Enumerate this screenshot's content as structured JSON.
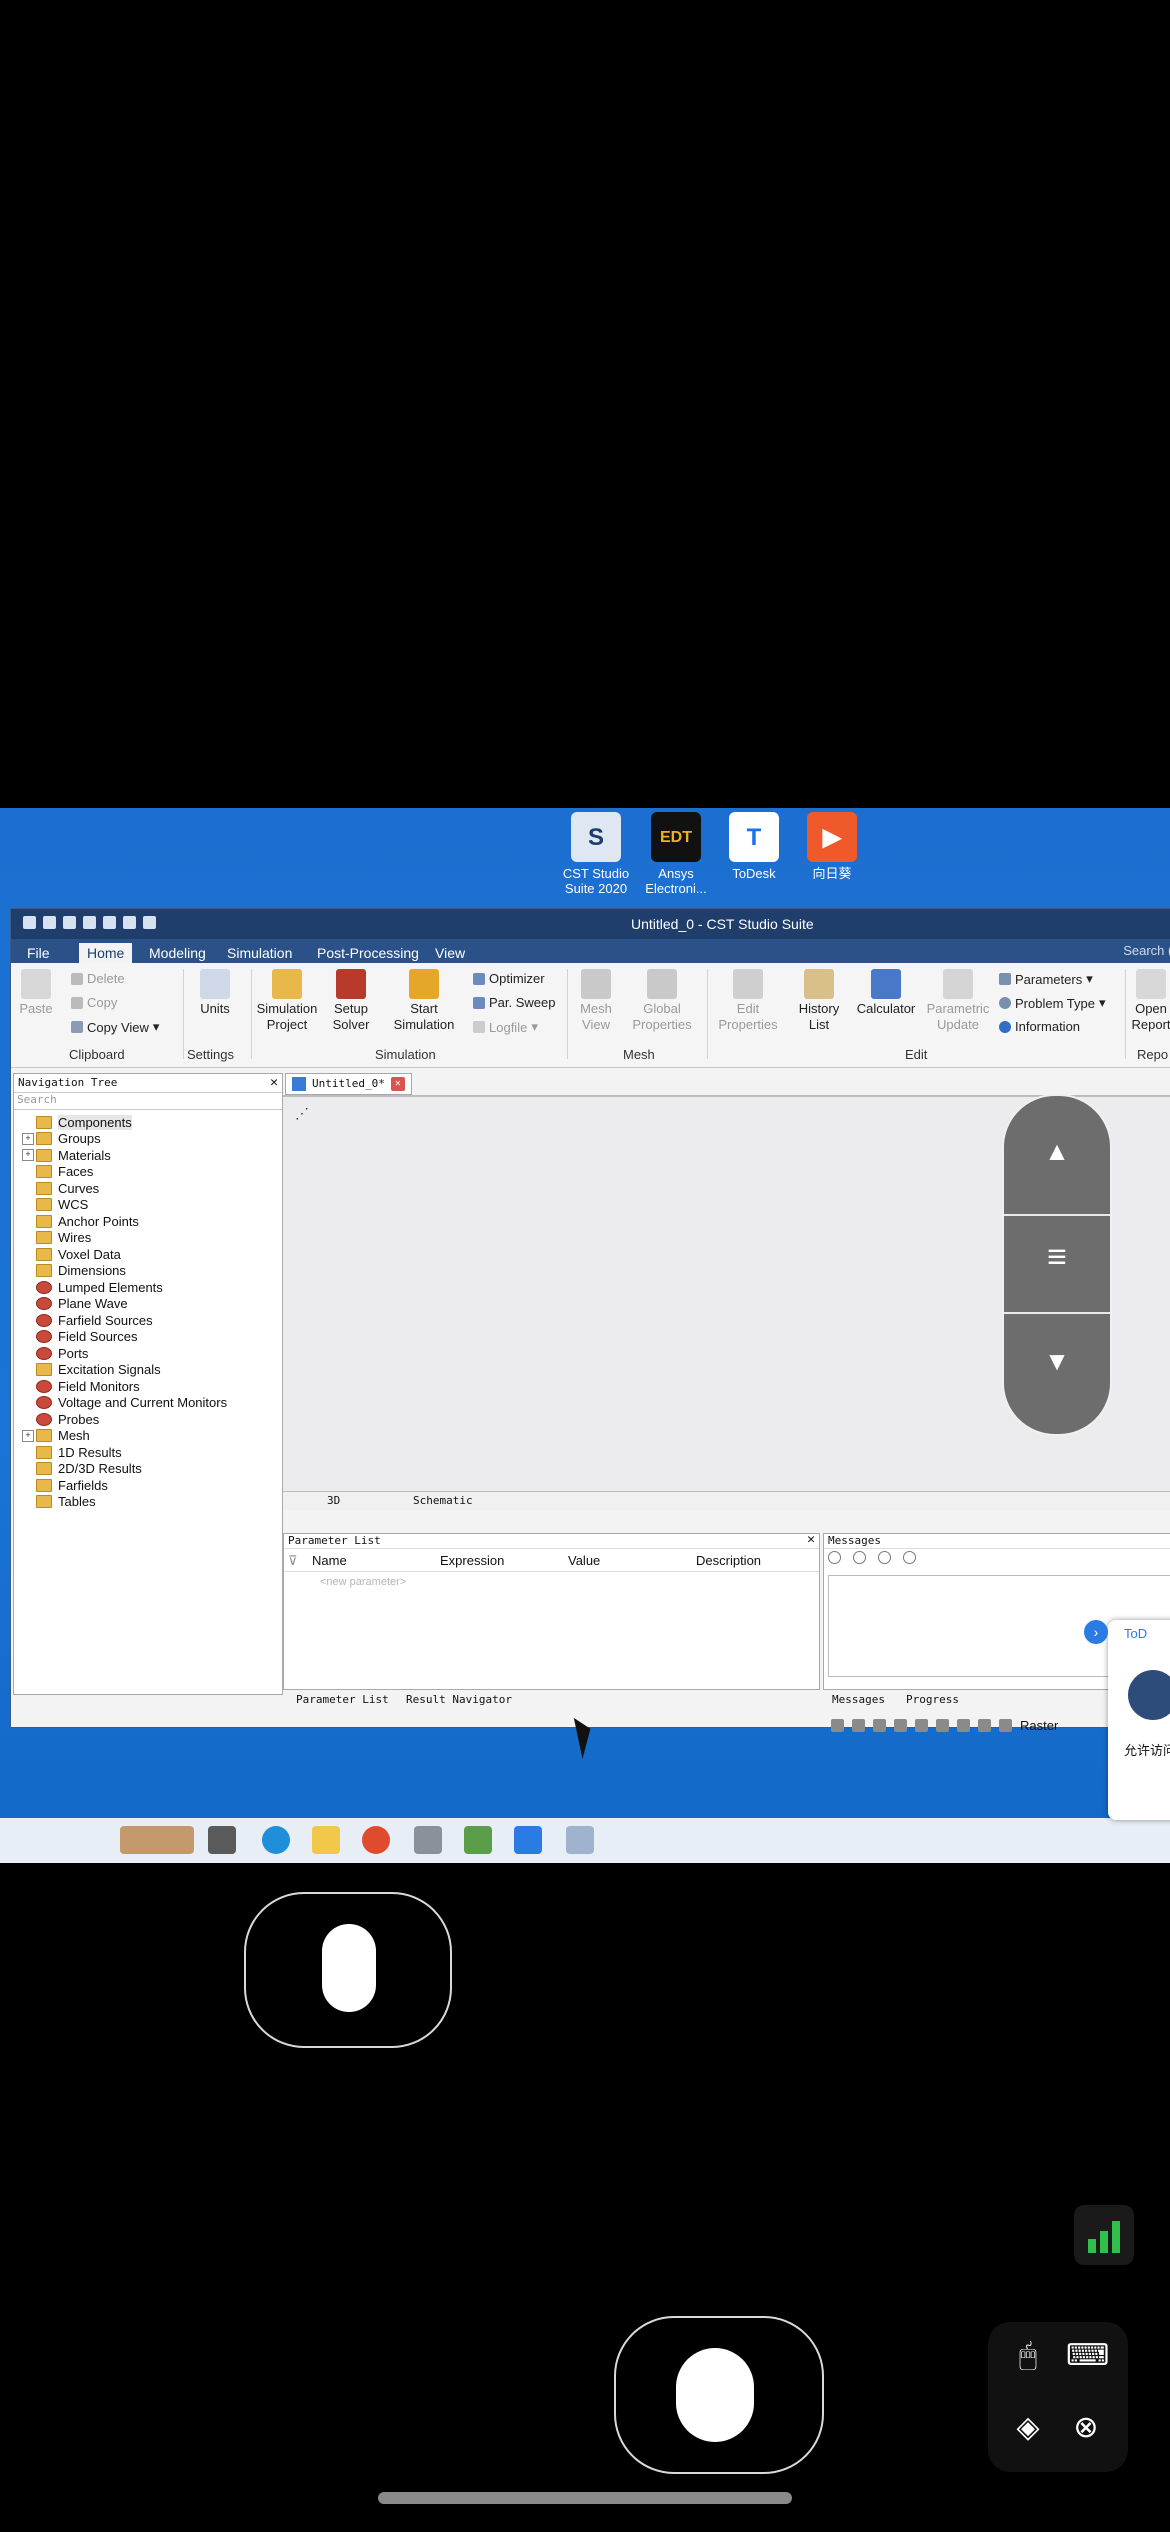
{
  "desktop_icons": [
    {
      "label": "CST Studio Suite 2020",
      "icon": "cst-icon"
    },
    {
      "label": "Ansys Electroni...",
      "icon": "ansys-edt-icon"
    },
    {
      "label": "ToDesk",
      "icon": "todesk-icon"
    },
    {
      "label": "向日葵",
      "icon": "sunflower-icon"
    }
  ],
  "window": {
    "title": "Untitled_0 - CST Studio Suite",
    "menu": [
      "File",
      "Home",
      "Modeling",
      "Simulation",
      "Post-Processing",
      "View"
    ],
    "active_menu": "Home",
    "search_placeholder": "Search (A"
  },
  "ribbon": {
    "clipboard": {
      "paste": "Paste",
      "delete": "Delete",
      "copy": "Copy",
      "copy_view": "Copy View",
      "group": "Clipboard"
    },
    "settings": {
      "units": "Units",
      "group": "Settings"
    },
    "simulation": {
      "simulation_project": "Simulation Project",
      "setup_solver": "Setup Solver",
      "start_simulation": "Start Simulation",
      "optimizer": "Optimizer",
      "par_sweep": "Par. Sweep",
      "logfile": "Logfile",
      "group": "Simulation"
    },
    "mesh": {
      "mesh_view": "Mesh View",
      "global_properties": "Global Properties",
      "group": "Mesh"
    },
    "edit": {
      "edit_properties": "Edit Properties",
      "history_list": "History List",
      "calculator": "Calculator",
      "parametric_update": "Parametric Update",
      "parameters": "Parameters",
      "problem_type": "Problem Type",
      "information": "Information",
      "group": "Edit"
    },
    "report": {
      "open_report": "Open Report",
      "group": "Repo"
    }
  },
  "navigation_tree": {
    "header": "Navigation Tree",
    "search": "Search",
    "items": [
      {
        "label": "Components",
        "expandable": false,
        "red": false
      },
      {
        "label": "Groups",
        "expandable": true,
        "red": false
      },
      {
        "label": "Materials",
        "expandable": true,
        "red": false
      },
      {
        "label": "Faces",
        "expandable": false,
        "red": false
      },
      {
        "label": "Curves",
        "expandable": false,
        "red": false
      },
      {
        "label": "WCS",
        "expandable": false,
        "red": false
      },
      {
        "label": "Anchor Points",
        "expandable": false,
        "red": false
      },
      {
        "label": "Wires",
        "expandable": false,
        "red": false
      },
      {
        "label": "Voxel Data",
        "expandable": false,
        "red": false
      },
      {
        "label": "Dimensions",
        "expandable": false,
        "red": false
      },
      {
        "label": "Lumped Elements",
        "expandable": false,
        "red": true
      },
      {
        "label": "Plane Wave",
        "expandable": false,
        "red": true
      },
      {
        "label": "Farfield Sources",
        "expandable": false,
        "red": true
      },
      {
        "label": "Field Sources",
        "expandable": false,
        "red": true
      },
      {
        "label": "Ports",
        "expandable": false,
        "red": true
      },
      {
        "label": "Excitation Signals",
        "expandable": false,
        "red": false
      },
      {
        "label": "Field Monitors",
        "expandable": false,
        "red": true
      },
      {
        "label": "Voltage and Current Monitors",
        "expandable": false,
        "red": true
      },
      {
        "label": "Probes",
        "expandable": false,
        "red": true
      },
      {
        "label": "Mesh",
        "expandable": true,
        "red": false
      },
      {
        "label": "1D Results",
        "expandable": false,
        "red": false
      },
      {
        "label": "2D/3D Results",
        "expandable": false,
        "red": false
      },
      {
        "label": "Farfields",
        "expandable": false,
        "red": false
      },
      {
        "label": "Tables",
        "expandable": false,
        "red": false
      }
    ]
  },
  "document_tab": "Untitled_0*",
  "view_tabs": [
    "3D",
    "Schematic"
  ],
  "parameter_list": {
    "header": "Parameter List",
    "columns": [
      "Name",
      "Expression",
      "Value",
      "Description"
    ],
    "new_row": "<new parameter>",
    "tabs": [
      "Parameter List",
      "Result Navigator"
    ]
  },
  "messages": {
    "header": "Messages",
    "tabs": [
      "Messages",
      "Progress"
    ]
  },
  "statusbar": {
    "raster": "Raster"
  },
  "todesk_popup": {
    "title": "ToD",
    "text": "允许访问"
  },
  "colors": {
    "title_bar": "#1f3e6b",
    "desktop": "#1a73d6",
    "accent": "#2a5288"
  }
}
